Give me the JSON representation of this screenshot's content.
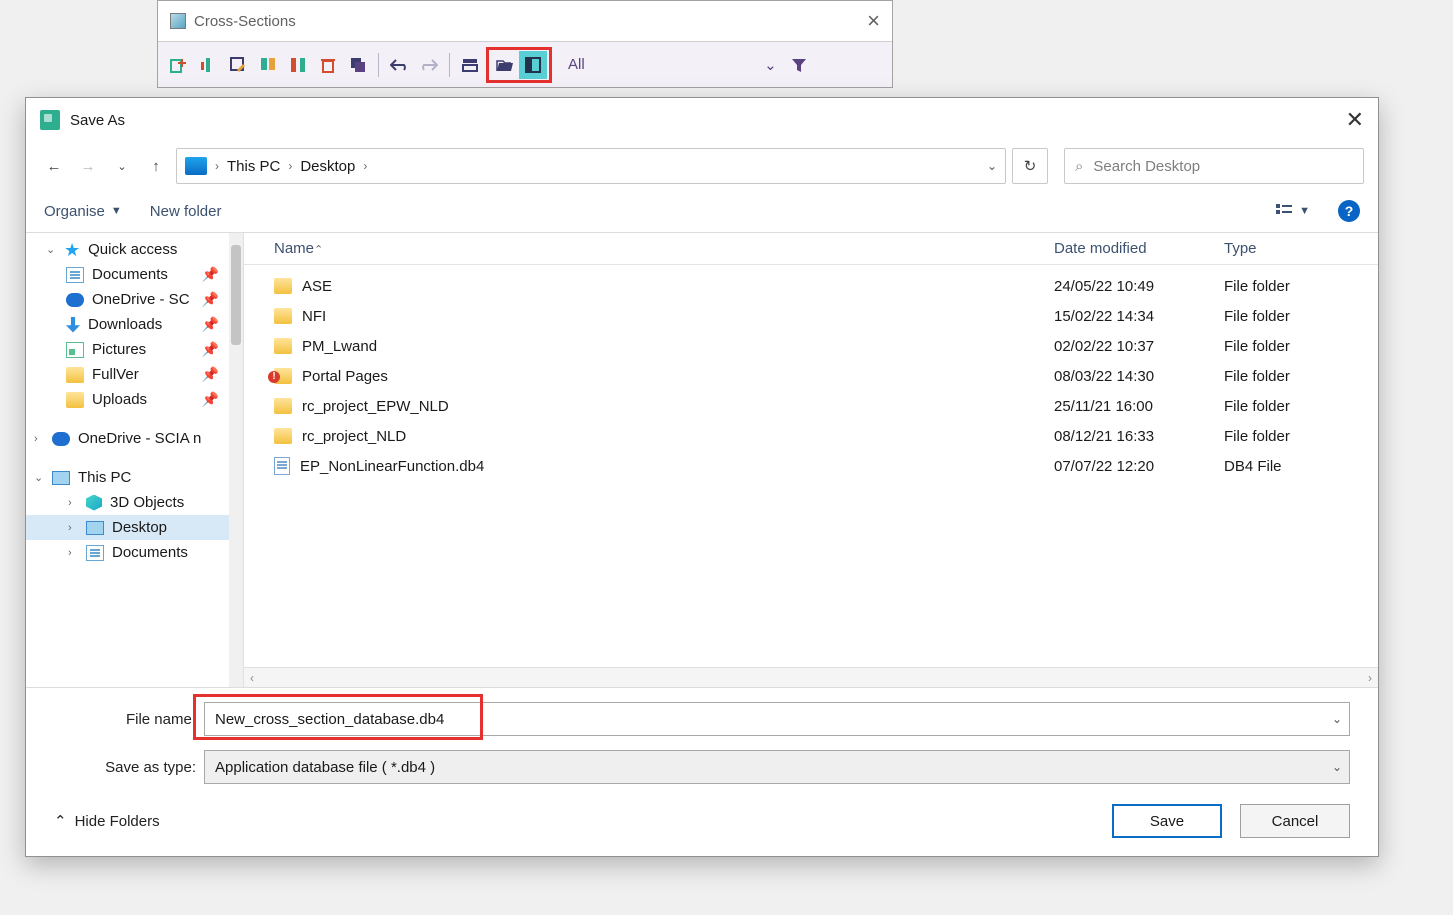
{
  "cross_sections": {
    "title": "Cross-Sections",
    "filter_text": "All"
  },
  "save_as": {
    "title": "Save As",
    "breadcrumb": {
      "root": "This PC",
      "folder": "Desktop"
    },
    "search_placeholder": "Search Desktop",
    "organise_label": "Organise",
    "newfolder_label": "New folder",
    "columns": {
      "name": "Name",
      "date": "Date modified",
      "type": "Type"
    },
    "sidebar": {
      "quick_access": "Quick access",
      "items": [
        {
          "label": "Documents"
        },
        {
          "label": "OneDrive - SC"
        },
        {
          "label": "Downloads"
        },
        {
          "label": "Pictures"
        },
        {
          "label": "FullVer"
        },
        {
          "label": "Uploads"
        }
      ],
      "onedrive": "OneDrive - SCIA n",
      "this_pc": "This PC",
      "this_pc_children": [
        {
          "label": "3D Objects"
        },
        {
          "label": "Desktop"
        },
        {
          "label": "Documents"
        }
      ]
    },
    "files": [
      {
        "name": "ASE",
        "date": "24/05/22 10:49",
        "type": "File folder",
        "kind": "folder"
      },
      {
        "name": "NFI",
        "date": "15/02/22 14:34",
        "type": "File folder",
        "kind": "folder"
      },
      {
        "name": "PM_Lwand",
        "date": "02/02/22 10:37",
        "type": "File folder",
        "kind": "folder"
      },
      {
        "name": "Portal Pages",
        "date": "08/03/22 14:30",
        "type": "File folder",
        "kind": "folder-alert"
      },
      {
        "name": "rc_project_EPW_NLD",
        "date": "25/11/21 16:00",
        "type": "File folder",
        "kind": "folder"
      },
      {
        "name": "rc_project_NLD",
        "date": "08/12/21 16:33",
        "type": "File folder",
        "kind": "folder"
      },
      {
        "name": "EP_NonLinearFunction.db4",
        "date": "07/07/22 12:20",
        "type": "DB4 File",
        "kind": "db4"
      }
    ],
    "form": {
      "filename_label": "File name:",
      "filename_value": "New_cross_section_database.db4",
      "saveastype_label": "Save as type:",
      "saveastype_value": "Application database file ( *.db4 )"
    },
    "actions": {
      "hide_folders": "Hide Folders",
      "save": "Save",
      "cancel": "Cancel"
    }
  }
}
